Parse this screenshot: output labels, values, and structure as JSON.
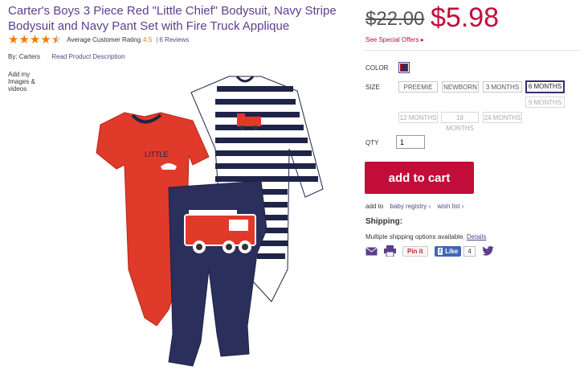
{
  "product": {
    "title": "Carter's Boys 3 Piece Red \"Little Chief\" Bodysuit, Navy Stripe Bodysuit and Navy Pant Set with Fire Truck Applique",
    "rating_label": "Average Customer Rating",
    "rating_value": "4.5",
    "rating_fraction": 0.9,
    "separator": "|",
    "reviews": "6 Reviews",
    "by_label": "By: Carters",
    "read_desc": "Read Product Description",
    "add_images": "Add my Images & videos",
    "image_icon": "bodysuit-set-product-image"
  },
  "pricing": {
    "old_price": "$22.00",
    "new_price": "$5.98",
    "special_offers": "See Special Offers ▸"
  },
  "options": {
    "color_label": "COLOR",
    "size_label": "SIZE",
    "sizes": [
      "PREEMIE",
      "NEWBORN",
      "3 MONTHS",
      "6 MONTHS",
      "9 MONTHS",
      "12 MONTHS",
      "18 MONTHS",
      "24 MONTHS"
    ],
    "selected_size": "6 MONTHS",
    "qty_label": "QTY",
    "qty_value": "1"
  },
  "cart": {
    "add_to_cart": "add to cart",
    "add_to": "add to",
    "baby_registry": "baby registry ›",
    "wish_list": "wish list ›"
  },
  "shipping": {
    "heading": "Shipping:",
    "text": "Multiple shipping options available.",
    "details": "Details"
  },
  "share": {
    "pinit": "Pin it",
    "fb_like": "Like",
    "fb_count": "4",
    "icons": [
      "email-icon",
      "print-icon",
      "pinterest-icon",
      "facebook-icon",
      "twitter-icon"
    ]
  },
  "colors": {
    "brand_purple": "#5b3f8c",
    "price_red": "#c20d3a",
    "star_orange": "#f07d00",
    "navy": "#2a2f5c",
    "red_garment": "#e03a2a"
  }
}
